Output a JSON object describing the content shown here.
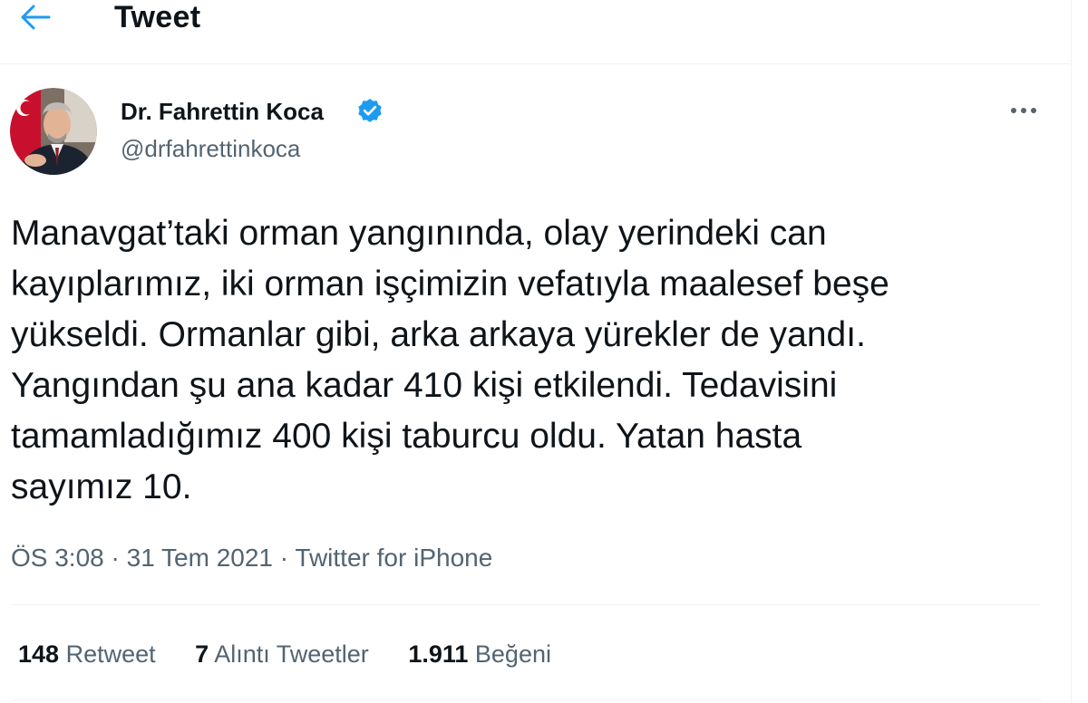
{
  "header": {
    "title": "Tweet"
  },
  "colors": {
    "accent": "#1d9bf0",
    "text": "#0f1419",
    "secondary": "#536471",
    "divider": "#eff3f4"
  },
  "tweet": {
    "author": {
      "name": "Dr. Fahrettin Koca",
      "handle": "@drfahrettinkoca",
      "verified": true
    },
    "text": "Manavgat’taki orman yangınında, olay yerindeki can\nkayıplarımız, iki orman işçimizin vefatıyla maalesef beşe\nyükseldi. Ormanlar gibi, arka arkaya yürekler de yandı.\nYangından şu ana kadar 410 kişi etkilendi. Tedavisini\ntamamladığımız 400 kişi taburcu oldu. Yatan hasta\nsayımız 10.",
    "time": "ÖS 3:08",
    "date": "31 Tem 2021",
    "separator": "·",
    "source": "Twitter for iPhone"
  },
  "stats": {
    "retweets": {
      "count": "148",
      "label": "Retweet"
    },
    "quotes": {
      "count": "7",
      "label": "Alıntı Tweetler"
    },
    "likes": {
      "count": "1.911",
      "label": "Beğeni"
    }
  },
  "icons": {
    "back": "arrow-left-icon",
    "verified": "verified-badge-icon",
    "more": "more-horizontal-icon"
  }
}
